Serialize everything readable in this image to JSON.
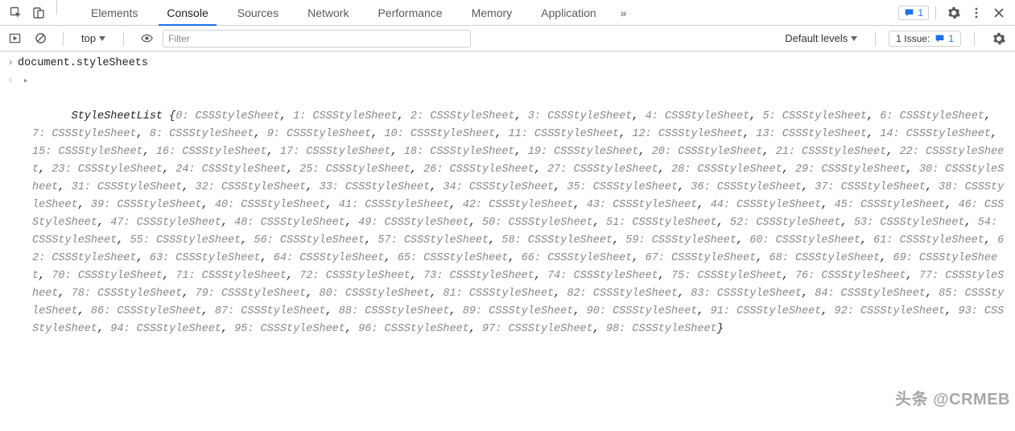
{
  "tabs": {
    "items": [
      "Elements",
      "Console",
      "Sources",
      "Network",
      "Performance",
      "Memory",
      "Application"
    ],
    "active_index": 1,
    "overflow_glyph": "»"
  },
  "tabbar_right": {
    "messages_count": "1"
  },
  "toolbar": {
    "context_label": "top",
    "filter_placeholder": "Filter",
    "levels_label": "Default levels",
    "issues_label": "1 Issue:",
    "issues_count": "1"
  },
  "console": {
    "input_prompt": "›",
    "output_prompt": "‹",
    "expand_glyph": "▸",
    "input_text": "document.styleSheets",
    "output": {
      "type_name": "StyleSheetList",
      "open_brace": " {",
      "close_brace": "}",
      "separator": ", ",
      "entry_value": "CSSStyleSheet",
      "count": 99,
      "extra_keys": []
    }
  },
  "watermark": "头条 @CRMEB"
}
